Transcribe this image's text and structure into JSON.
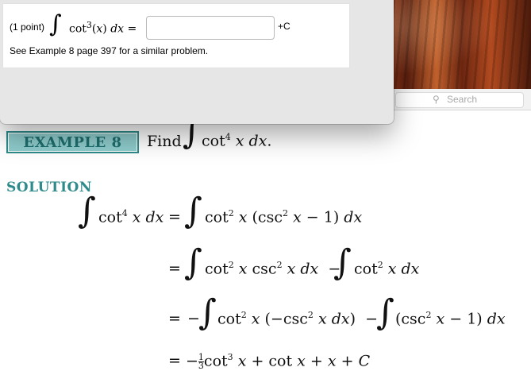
{
  "background": {
    "search_placeholder": "Search",
    "search_icon": "magnifier-icon"
  },
  "problem": {
    "points": "(1 point)",
    "integral_symbol": "∫",
    "expression_html": "cot<sup>3</sup>(<i>x</i>) <i>dx</i> =",
    "answer_value": "",
    "constant": "+C",
    "hint": "See Example 8 page 397 for a similar problem."
  },
  "textbook": {
    "example_label": "EXAMPLE 8",
    "find_text": "Find",
    "find_integrand_html": "cot<sup>4</sup> <i>x dx</i>.",
    "solution_label": "SOLUTION",
    "lines": [
      {
        "lhs_html": "cot<sup>4</sup> <i>x dx</i>",
        "eq": "="
      },
      {
        "eq": "="
      },
      {
        "eq": "="
      },
      {
        "eq": "="
      }
    ]
  },
  "colors": {
    "accent": "#2e8b8b",
    "label_fill": "#8fcccc",
    "dialog_bg": "#e6e6e6"
  }
}
